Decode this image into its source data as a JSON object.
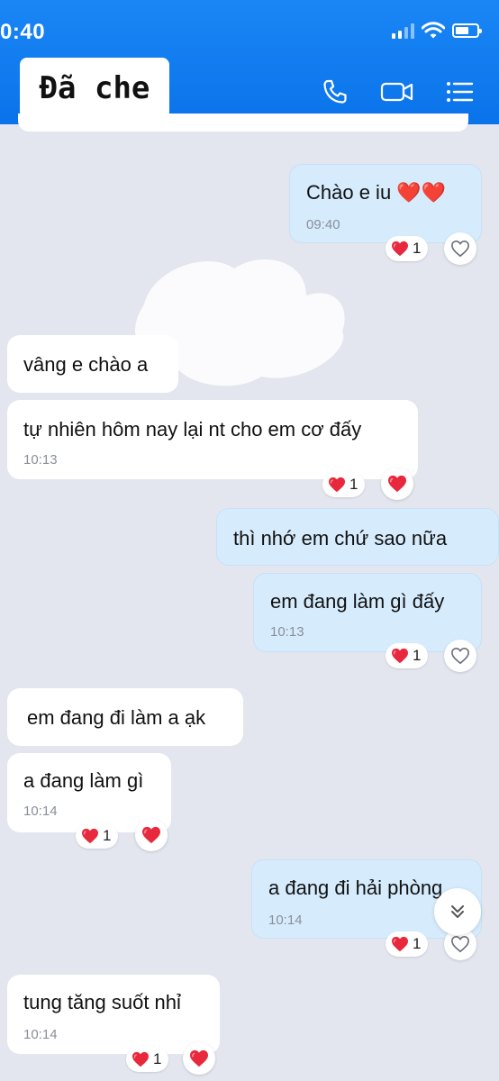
{
  "status": {
    "time": "0:40"
  },
  "header": {
    "title": "Đã che"
  },
  "messages": [
    {
      "text": "Chào e iu ❤️❤️",
      "time": "09:40",
      "reaction_count": "1"
    },
    {
      "text": "vâng e chào a"
    },
    {
      "text": "tự nhiên hôm nay lại nt cho em cơ đấy",
      "time": "10:13",
      "reaction_count": "1"
    },
    {
      "text": "thì nhớ em chứ sao nữa"
    },
    {
      "text": "em đang làm gì đấy",
      "time": "10:13",
      "reaction_count": "1"
    },
    {
      "text": "em đang đi làm a ạk"
    },
    {
      "text": "a đang làm gì",
      "time": "10:14",
      "reaction_count": "1"
    },
    {
      "text": "a đang đi hải phòng",
      "time": "10:14",
      "reaction_count": "1"
    },
    {
      "text": "tung tăng suốt nhỉ",
      "time": "10:14",
      "reaction_count": "1"
    }
  ],
  "colors": {
    "header": "#0a73ea",
    "sent_bubble": "#d6ecfd",
    "received_bubble": "#ffffff",
    "heart": "#e8283c"
  },
  "icons": [
    "phone-icon",
    "video-call-icon",
    "menu-icon",
    "heart-icon",
    "heart-outline-icon",
    "chevron-double-down-icon"
  ]
}
